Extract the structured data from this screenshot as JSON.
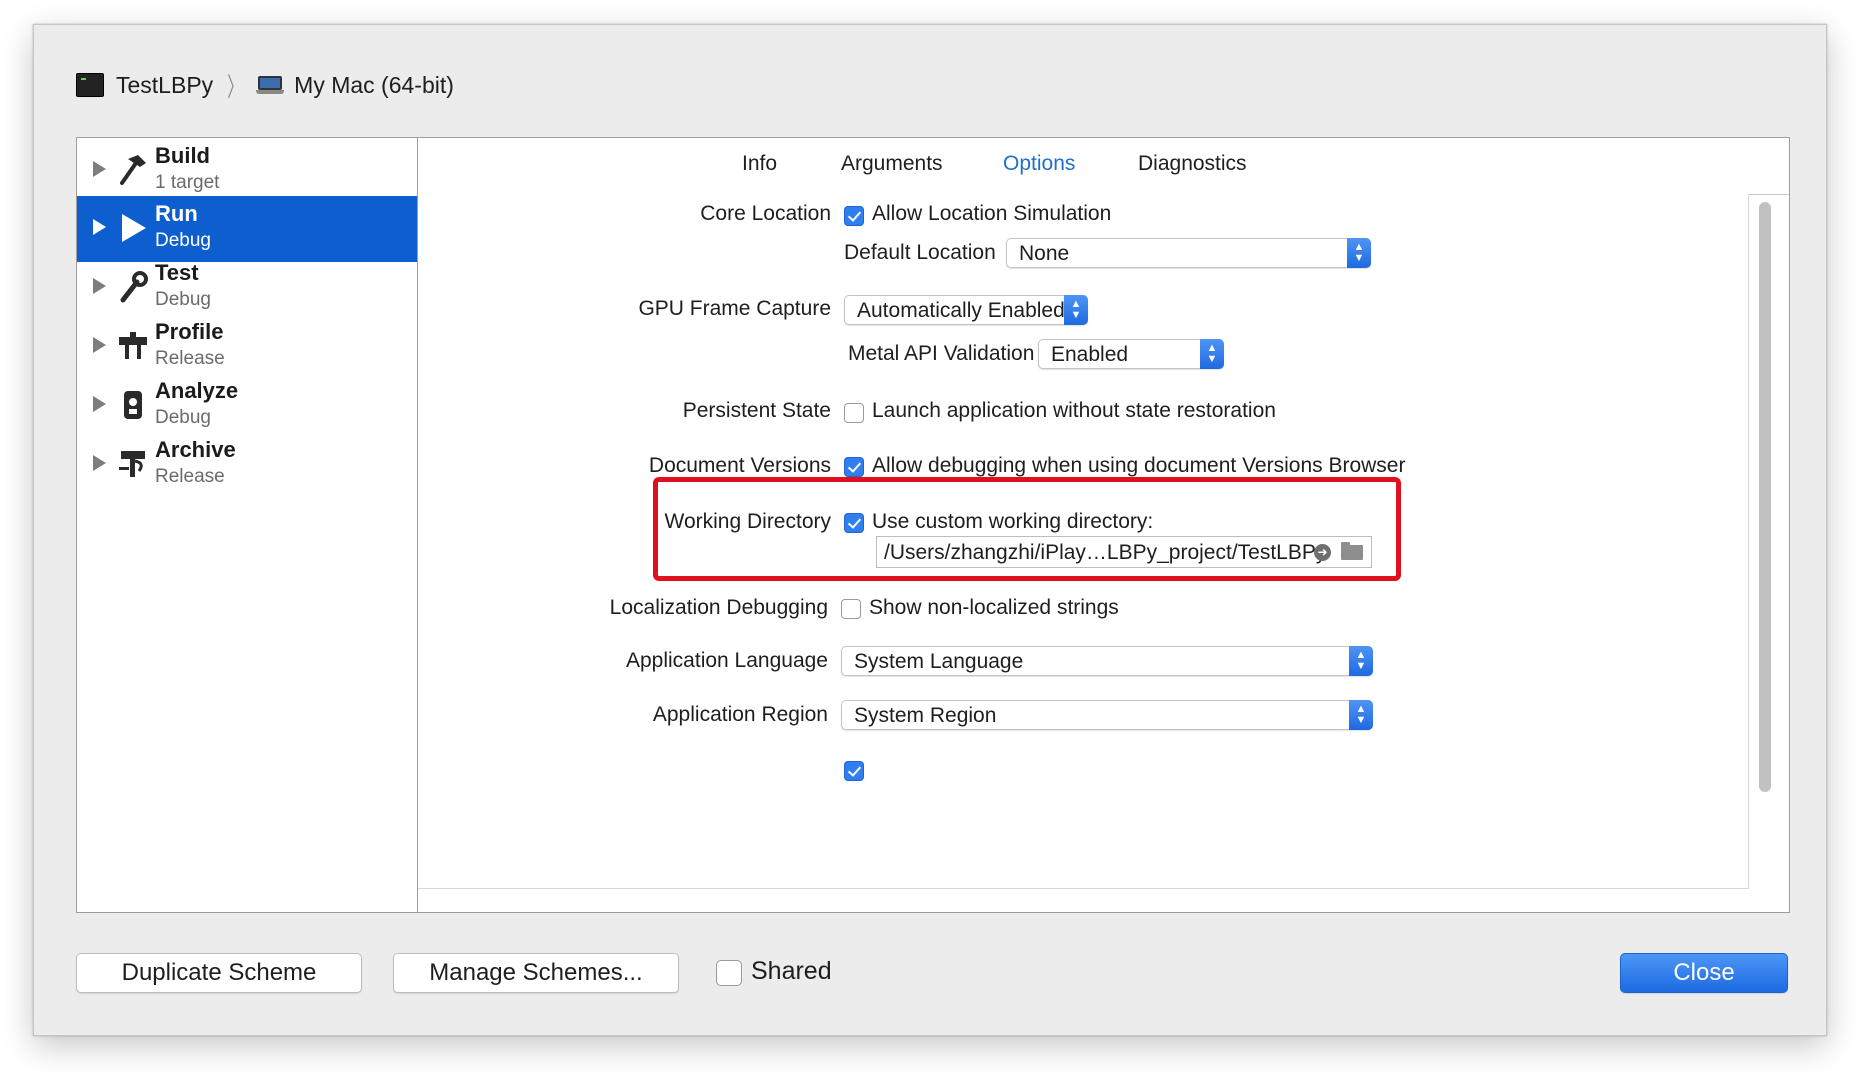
{
  "breadcrumb": {
    "scheme": "TestLBPy",
    "destination": "My Mac (64-bit)"
  },
  "sidebar": {
    "items": [
      {
        "name": "Build",
        "sub": "1 target",
        "icon": "hammer-icon"
      },
      {
        "name": "Run",
        "sub": "Debug",
        "icon": "play-icon",
        "selected": true
      },
      {
        "name": "Test",
        "sub": "Debug",
        "icon": "wrench-icon"
      },
      {
        "name": "Profile",
        "sub": "Release",
        "icon": "gauge-icon"
      },
      {
        "name": "Analyze",
        "sub": "Debug",
        "icon": "analyze-icon"
      },
      {
        "name": "Archive",
        "sub": "Release",
        "icon": "archive-icon"
      }
    ]
  },
  "tabs": [
    "Info",
    "Arguments",
    "Options",
    "Diagnostics"
  ],
  "active_tab": "Options",
  "options": {
    "core_location": {
      "label": "Core Location",
      "checkbox": "Allow Location Simulation",
      "checked": true
    },
    "default_location": {
      "label": "Default Location",
      "value": "None"
    },
    "gpu_frame_capture": {
      "label": "GPU Frame Capture",
      "value": "Automatically Enabled"
    },
    "metal_api_validation": {
      "label": "Metal API Validation",
      "value": "Enabled"
    },
    "persistent_state": {
      "label": "Persistent State",
      "checkbox": "Launch application without state restoration",
      "checked": false
    },
    "document_versions": {
      "label": "Document Versions",
      "checkbox": "Allow debugging when using document Versions Browser",
      "checked": true
    },
    "working_directory": {
      "label": "Working Directory",
      "checkbox": "Use custom working directory:",
      "checked": true,
      "path": "/Users/zhangzhi/iPlay…LBPy_project/TestLBPy"
    },
    "localization_debugging": {
      "label": "Localization Debugging",
      "checkbox": "Show non-localized strings",
      "checked": false
    },
    "application_language": {
      "label": "Application Language",
      "value": "System Language"
    },
    "application_region": {
      "label": "Application Region",
      "value": "System Region"
    }
  },
  "footer": {
    "duplicate": "Duplicate Scheme",
    "manage": "Manage Schemes...",
    "shared": "Shared",
    "shared_checked": false,
    "close": "Close"
  },
  "colors": {
    "accent": "#0d5fd0",
    "highlight": "#e01020",
    "active_tab": "#1f6fd2"
  }
}
